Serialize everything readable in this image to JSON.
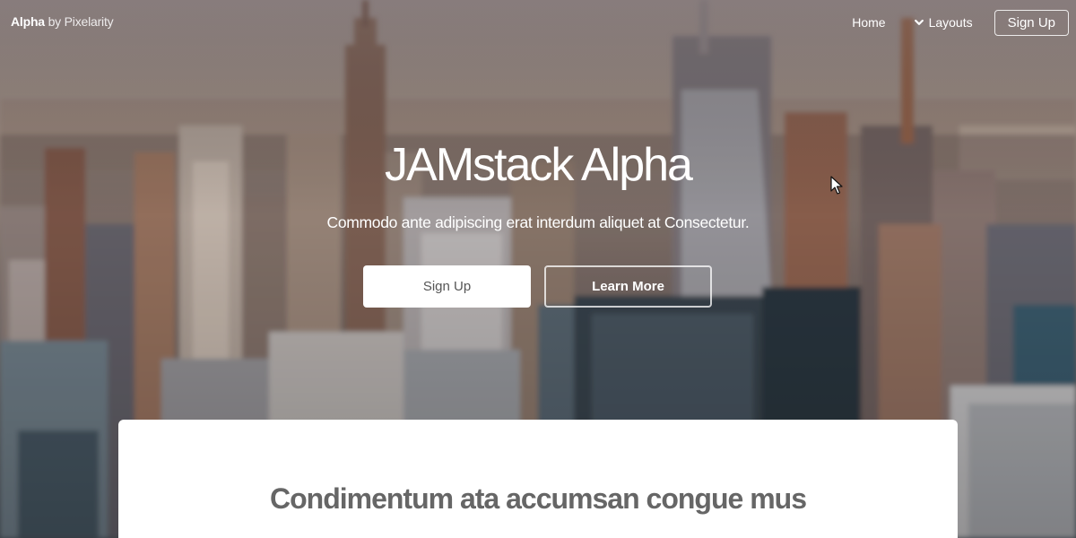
{
  "header": {
    "brand": "Alpha",
    "brand_suffix": " by Pixelarity",
    "nav": {
      "home": "Home",
      "layouts": "Layouts",
      "signup": "Sign Up"
    }
  },
  "hero": {
    "title": "JAMstack Alpha",
    "subtitle": "Commodo ante adipiscing erat interdum aliquet at Consectetur.",
    "primary_button": "Sign Up",
    "secondary_button": "Learn More"
  },
  "panel": {
    "heading": "Condimentum ata accumsan congue mus"
  },
  "icons": {
    "layouts_toggle": "chevron-down-icon",
    "pointer": "mouse-cursor-icon"
  },
  "colors": {
    "text_light": "#ffffff",
    "panel_bg": "#ffffff",
    "panel_text": "#666666"
  }
}
